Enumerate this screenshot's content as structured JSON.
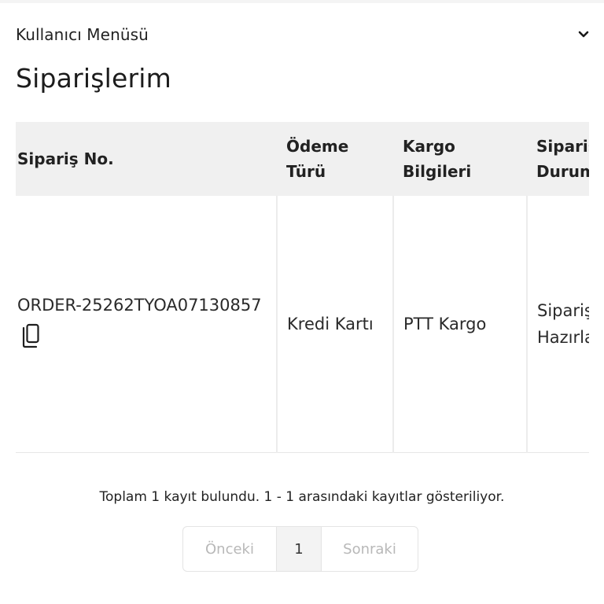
{
  "user_menu": {
    "title": "Kullanıcı Menüsü",
    "toggle_icon": "chevron-down-icon"
  },
  "page": {
    "title": "Siparişlerim"
  },
  "orders_table": {
    "columns": [
      {
        "label": "Sipariş No."
      },
      {
        "label": "Ödeme Türü"
      },
      {
        "label": "Kargo Bilgileri"
      },
      {
        "label": "Sipariş Durumu"
      }
    ],
    "rows": [
      {
        "order_no": "ORDER-25262TYOA07130857",
        "copy_icon": "copy-icon",
        "payment_type": "Kredi Kartı",
        "shipping": "PTT Kargo",
        "status": "Sipariş Hazırlanıyor"
      }
    ]
  },
  "pagination": {
    "summary": "Toplam 1 kayıt bulundu. 1 - 1 arasındaki kayıtlar gösteriliyor.",
    "prev_label": "Önceki",
    "current_page": "1",
    "next_label": "Sonraki"
  },
  "colors": {
    "header_bg": "#f0f0f0",
    "text": "#222222",
    "muted": "#b8b8b8",
    "border": "#e4e4e4"
  }
}
